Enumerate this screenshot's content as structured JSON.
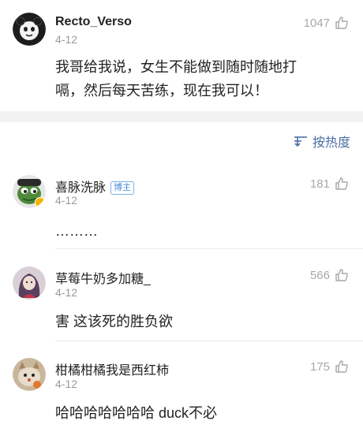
{
  "main_comment": {
    "username": "Recto_Verso",
    "date": "4-12",
    "likes": "1047",
    "text_line1": "我哥给我说，女生不能做到随时随地打",
    "text_line2": "嗝，然后每天苦练，现在我可以！"
  },
  "sort": {
    "label": "按热度"
  },
  "replies": [
    {
      "username": "喜脉洗脉",
      "badge": "博主",
      "date": "4-12",
      "likes": "181",
      "text": "………"
    },
    {
      "username": "草莓牛奶多加糖_",
      "date": "4-12",
      "likes": "566",
      "text": "害 这该死的胜负欲"
    },
    {
      "username": "柑橘柑橘我是西红柿",
      "date": "4-12",
      "likes": "175",
      "text": "哈哈哈哈哈哈哈 duck不必"
    }
  ],
  "colors": {
    "link": "#4a6fa5",
    "muted": "#9a9a9a",
    "separator": "#f2f2f2"
  }
}
